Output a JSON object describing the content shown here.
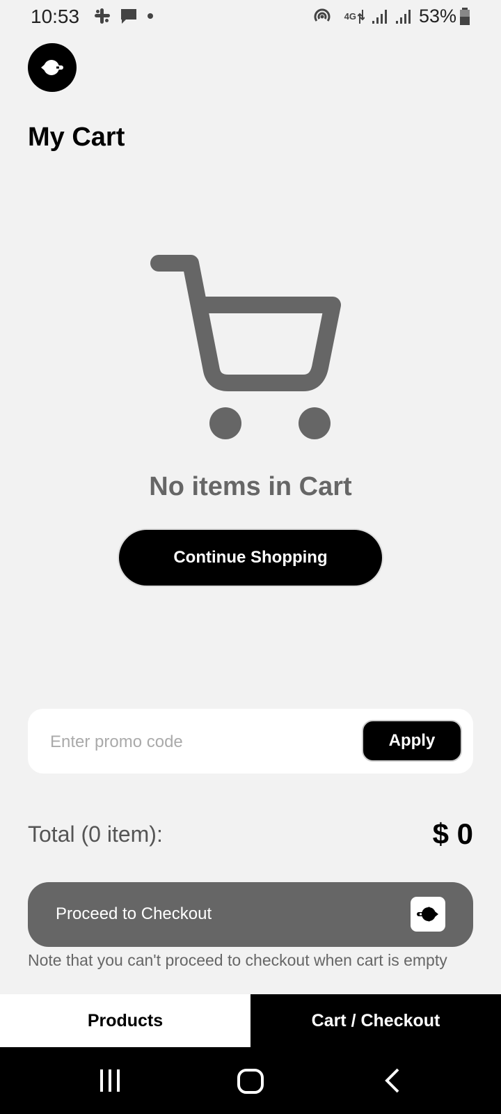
{
  "status_bar": {
    "time": "10:53",
    "network": "4G",
    "battery": "53%",
    "left_icons": [
      "slack-icon",
      "message-icon",
      "dot-icon"
    ],
    "right_icons": [
      "hotspot-icon",
      "data-arrows-icon",
      "signal-icon",
      "signal-icon",
      "battery-icon"
    ]
  },
  "header": {
    "back_icon": "back-arrow-icon",
    "title": "My Cart"
  },
  "empty_state": {
    "icon": "cart-icon",
    "message": "No items in Cart",
    "continue_label": "Continue Shopping"
  },
  "promo": {
    "placeholder": "Enter promo code",
    "value": "",
    "apply_label": "Apply"
  },
  "total": {
    "label": "Total (0 item):",
    "value": "$ 0"
  },
  "checkout": {
    "label": "Proceed to Checkout",
    "icon": "arrow-right-icon",
    "note": "Note that you can't proceed to checkout when cart is empty"
  },
  "tabs": [
    {
      "label": "Products",
      "active": false
    },
    {
      "label": "Cart / Checkout",
      "active": true
    }
  ],
  "colors": {
    "background": "#f2f2f2",
    "primary": "#000000",
    "disabled": "#666666",
    "muted_text": "#666666"
  }
}
